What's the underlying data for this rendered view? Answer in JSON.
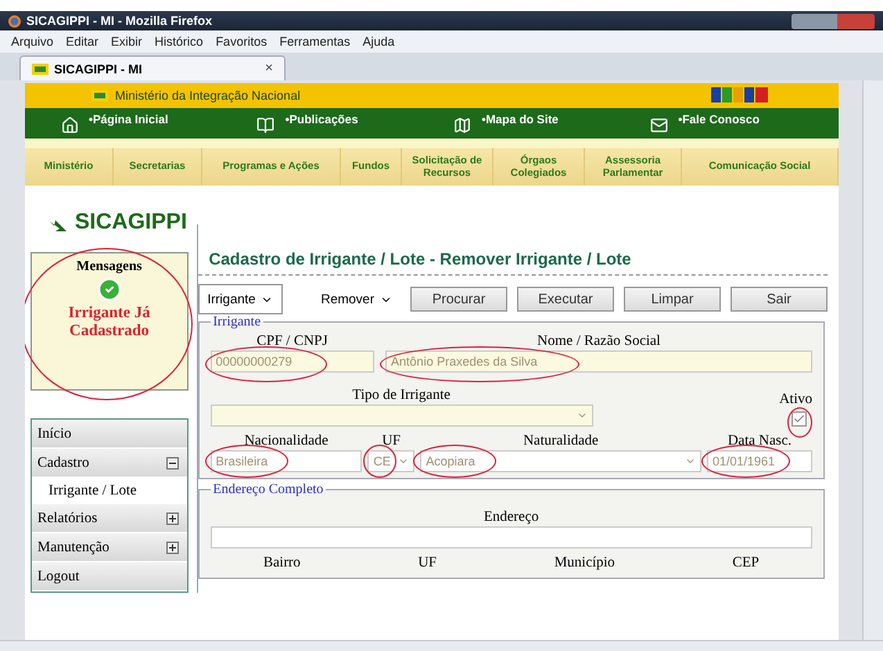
{
  "browser": {
    "title": "SICAGIPPI - MI - Mozilla Firefox",
    "menu": [
      "Arquivo",
      "Editar",
      "Exibir",
      "Histórico",
      "Favoritos",
      "Ferramentas",
      "Ajuda"
    ],
    "tab": "SICAGIPPI - MI",
    "close": "×"
  },
  "site": {
    "ministry": "Ministério da Integração Nacional",
    "links": [
      "•Página Inicial",
      "•Publicações",
      "•Mapa do Site",
      "•Fale Conosco"
    ],
    "nav": [
      "Ministério",
      "Secretarias",
      "Programas e Ações",
      "Fundos",
      "Solicitação de Recursos",
      "Órgaos Colegiados",
      "Assessoria Parlamentar",
      "Comunicação Social"
    ]
  },
  "app": {
    "logo": "SICAGIPPI",
    "messages": {
      "title": "Mensagens",
      "text": "Irrigante Já Cadastrado",
      "circled": true
    },
    "sidebar": [
      {
        "label": "Início"
      },
      {
        "label": "Cadastro",
        "expanded": true,
        "children": [
          {
            "label": "Irrigante / Lote"
          }
        ]
      },
      {
        "label": "Relatórios",
        "expanded": false
      },
      {
        "label": "Manutenção",
        "expanded": false
      },
      {
        "label": "Logout"
      }
    ]
  },
  "form": {
    "title": "Cadastro de Irrigante / Lote - Remover Irrigante / Lote",
    "entity": "Irrigante",
    "action": "Remover",
    "buttons": [
      "Procurar",
      "Executar",
      "Limpar",
      "Sair"
    ],
    "irrigante": {
      "legend": "Irrigante",
      "cpf": {
        "label": "CPF / CNPJ",
        "value": "00000000279",
        "circled": true
      },
      "nome": {
        "label": "Nome / Razão Social",
        "value": "Antônio Praxedes da Silva",
        "circled": true
      },
      "tipo": {
        "label": "Tipo de Irrigante"
      },
      "ativo": {
        "label": "Ativo",
        "checked": true,
        "circled": true
      },
      "nacionalidade": {
        "label": "Nacionalidade",
        "value": "Brasileira",
        "circled": true
      },
      "uf": {
        "label": "UF",
        "value": "CE",
        "circled": true
      },
      "naturalidade": {
        "label": "Naturalidade",
        "value": "Acopiara",
        "circled": true
      },
      "nascimento": {
        "label": "Data Nasc.",
        "value": "01/01/1961",
        "circled": true
      }
    },
    "endereco": {
      "legend": "Endereço Completo",
      "endereco": {
        "label": "Endereço"
      },
      "labels": [
        "Bairro",
        "UF",
        "Município",
        "CEP"
      ]
    }
  }
}
